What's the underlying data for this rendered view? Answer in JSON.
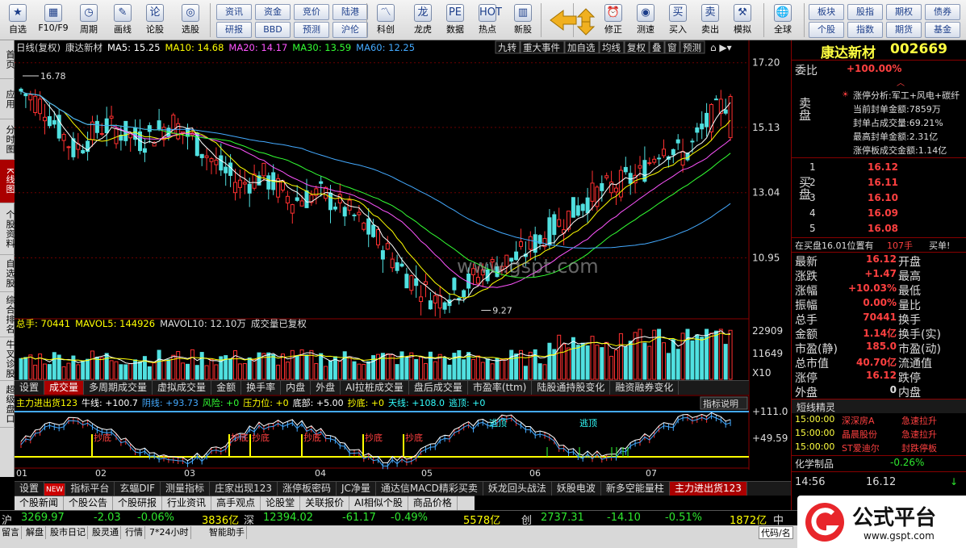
{
  "toolbar": {
    "items": [
      {
        "label": "自选",
        "icon": "★"
      },
      {
        "label": "F10/F9",
        "icon": "▦"
      },
      {
        "label": "周期",
        "icon": "◷"
      },
      {
        "label": "画线",
        "icon": "✎"
      },
      {
        "label": "论股",
        "icon": "论"
      },
      {
        "label": "选股",
        "icon": "◎"
      },
      {
        "label": "科创",
        "icon": "〽"
      },
      {
        "label": "龙虎",
        "icon": "龙"
      },
      {
        "label": "数据",
        "icon": "PE"
      },
      {
        "label": "热点",
        "icon": "HOT"
      },
      {
        "label": "新股",
        "icon": "▥"
      },
      {
        "label": "修正",
        "icon": "⏰"
      },
      {
        "label": "测速",
        "icon": "◉"
      },
      {
        "label": "买入",
        "icon": "买"
      },
      {
        "label": "卖出",
        "icon": "卖"
      },
      {
        "label": "模拟",
        "icon": "⚒"
      },
      {
        "label": "全球",
        "icon": "🌐"
      }
    ],
    "mid_buttons": [
      "资讯",
      "资金",
      "竞价",
      "陆港",
      "研报",
      "BBD",
      "预测",
      "沪伦"
    ],
    "right_buttons": [
      "板块",
      "股指",
      "期权",
      "债券",
      "个股",
      "指数",
      "期货",
      "基金"
    ]
  },
  "leftnav": [
    "首页",
    "应用",
    "分时图",
    "K线图",
    "个股资料",
    "自选股",
    "综合排名",
    "牛叉诊股",
    "超级盘口"
  ],
  "kline": {
    "title": "日线(复权)",
    "name": "康达新材",
    "ma5": "MA5: 15.25",
    "ma10": "MA10: 14.68",
    "ma20": "MA20: 14.17",
    "ma30": "MA30: 13.59",
    "ma60": "MA60: 12.25",
    "high_label": "16.78",
    "low_label": "9.27",
    "watermark": "www.gspt.com",
    "top_buttons": [
      "九转",
      "重大事件",
      "加自选",
      "均线",
      "复权",
      "叠",
      "窗",
      "预测"
    ],
    "price_axis": [
      "17.20",
      "15.13",
      "13.04",
      "10.95"
    ]
  },
  "volume": {
    "label": "总手: 70441",
    "mavol5": "MAVOL5: 144926",
    "mavol10": "MAVOL10: 12.10万",
    "note": "成交量已复权",
    "axis": [
      "22909",
      "11649",
      "X10"
    ]
  },
  "vol_tabs": [
    "设置",
    "成交量",
    "多周期成交量",
    "虚拟成交量",
    "金额",
    "换手率",
    "内盘",
    "外盘",
    "AI拉桩成交量",
    "盘后成交量",
    "市盈率(ttm)",
    "陆股通持股变化",
    "融资融券变化"
  ],
  "indicator": {
    "name": "主力进出货123",
    "niu": "牛线: +100.7",
    "yin": "阴线: +93.73",
    "risk": "风险: +0",
    "pressure": "压力位: +0",
    "bottom": "底部: +5.00",
    "chaodi": "抄底: +0",
    "tianxian": "天线: +108.0",
    "taoding": "逃顶: +0",
    "button": "指标说明",
    "axis": [
      "+111.0",
      "+49.59"
    ],
    "labels": [
      "抄底",
      "抄底",
      "抄底",
      "抄底",
      "抄底",
      "抄底",
      "逃顶",
      "逃顶"
    ]
  },
  "months": [
    "01",
    "02",
    "03",
    "04",
    "05",
    "06",
    "07"
  ],
  "ind_tabs": [
    "设置",
    "NEW",
    "指标平台",
    "玄蝠DIF",
    "测量指标",
    "庄家出现123",
    "涨停板密码",
    "JC净量",
    "通达信MACD精彩买卖",
    "妖龙回头战法",
    "妖股电波",
    "新多空能量柱",
    "主力进出货123"
  ],
  "news_tabs": [
    "个股新闻",
    "个股公告",
    "个股研报",
    "行业资讯",
    "高手观点",
    "论股堂",
    "关联报价",
    "AI相似个股",
    "商品价格"
  ],
  "quote": {
    "name": "康达新材",
    "code": "002669",
    "weibi_label": "委比",
    "weibi": "+100.00%",
    "zt_lines": [
      "涨停分析:军工+风电+碳纤",
      "当前封单金额:7859万",
      "封单占成交量:69.21%",
      "最高封单金额:2.31亿",
      "涨停板成交金额:1.14亿"
    ],
    "sell_label": "卖盘",
    "buy_label": "买盘",
    "buy": [
      [
        "1",
        "16.12"
      ],
      [
        "2",
        "16.11"
      ],
      [
        "3",
        "16.10"
      ],
      [
        "4",
        "16.09"
      ],
      [
        "5",
        "16.08"
      ]
    ],
    "notice": "在买盘16.01位置有",
    "notice_vol": "107手",
    "notice_tail": "买单!",
    "stats": [
      [
        "最新",
        "16.12",
        "开盘",
        ""
      ],
      [
        "涨跌",
        "+1.47",
        "最高",
        ""
      ],
      [
        "涨幅",
        "+10.03%",
        "最低",
        ""
      ],
      [
        "振幅",
        "0.00%",
        "量比",
        ""
      ],
      [
        "总手",
        "70441",
        "换手",
        ""
      ],
      [
        "金额",
        "1.14亿",
        "换手(实)",
        ""
      ],
      [
        "市盈(静)",
        "185.0",
        "市盈(动)",
        ""
      ],
      [
        "总市值",
        "40.70亿",
        "流通值",
        ""
      ],
      [
        "涨停",
        "16.12",
        "跌停",
        ""
      ],
      [
        "外盘",
        "0",
        "内盘",
        ""
      ]
    ],
    "dxjl": "短线精灵",
    "dx": [
      [
        "15:00:00",
        "深深房A",
        "急速拉升"
      ],
      [
        "15:00:00",
        "晶晨股份",
        "急速拉升"
      ],
      [
        "15:00:00",
        "ST爱迪尔",
        "封跌停板"
      ]
    ],
    "sector": "化学制品",
    "sector_pct": "-0.26%",
    "time": "14:56",
    "last": "16.12"
  },
  "indexbar": {
    "sh": "沪",
    "sh_v": "3269.97",
    "sh_c": "-2.03",
    "sh_p": "-0.06%",
    "sh_a": "3836亿",
    "sz": "深",
    "sz_v": "12394.02",
    "sz_c": "-61.17",
    "sz_p": "-0.49%",
    "sz_a": "5578亿",
    "cy": "创",
    "cy_v": "2737.31",
    "cy_c": "-14.10",
    "cy_p": "-0.51%",
    "cy_a": "1872亿",
    "zz": "中"
  },
  "bottom": [
    "留言",
    "解盘",
    "股市日记",
    "股灵通",
    "行情",
    "7*24小时",
    "智能助手"
  ],
  "codebox": "代码/名",
  "logo": {
    "text": "公式平台",
    "url": "www.gspt.com"
  }
}
